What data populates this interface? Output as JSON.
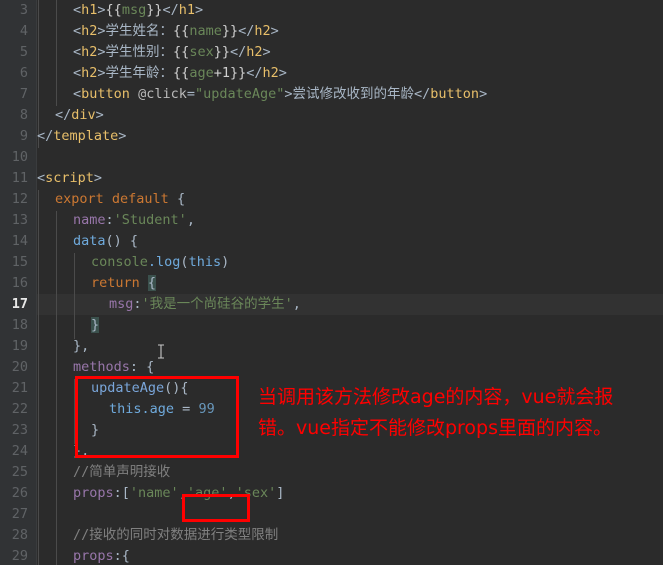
{
  "editor": {
    "background_color": "#2b2b2b",
    "gutter_color": "#313335",
    "active_line_color": "#323232",
    "annotation_color": "#ff0000",
    "first_visible_line": 3,
    "last_visible_line": 29,
    "active_line": 17
  },
  "line_numbers": [
    "3",
    "4",
    "5",
    "6",
    "7",
    "8",
    "9",
    "10",
    "11",
    "12",
    "13",
    "14",
    "15",
    "16",
    "17",
    "18",
    "19",
    "20",
    "21",
    "22",
    "23",
    "24",
    "25",
    "26",
    "27",
    "28",
    "29"
  ],
  "code_lines": [
    {
      "num": "3",
      "text": "    <h1>{{msg}}</h1>"
    },
    {
      "num": "4",
      "text": "    <h2>学生姓名：{{name}}</h2>"
    },
    {
      "num": "5",
      "text": "    <h2>学生性别：{{sex}}</h2>"
    },
    {
      "num": "6",
      "text": "    <h2>学生年龄：{{age+1}}</h2>"
    },
    {
      "num": "7",
      "text": "    <button @click=\"updateAge\">尝试修改收到的年龄</button>"
    },
    {
      "num": "8",
      "text": "  </div>"
    },
    {
      "num": "9",
      "text": "</template>"
    },
    {
      "num": "10",
      "text": ""
    },
    {
      "num": "11",
      "text": "<script>"
    },
    {
      "num": "12",
      "text": "  export default {"
    },
    {
      "num": "13",
      "text": "    name:'Student',"
    },
    {
      "num": "14",
      "text": "    data() {"
    },
    {
      "num": "15",
      "text": "      console.log(this)"
    },
    {
      "num": "16",
      "text": "      return {"
    },
    {
      "num": "17",
      "text": "        msg:'我是一个尚硅谷的学生',"
    },
    {
      "num": "18",
      "text": "      }"
    },
    {
      "num": "19",
      "text": "    },"
    },
    {
      "num": "20",
      "text": "    methods: {"
    },
    {
      "num": "21",
      "text": "      updateAge(){"
    },
    {
      "num": "22",
      "text": "        this.age = 99"
    },
    {
      "num": "23",
      "text": "      }"
    },
    {
      "num": "24",
      "text": "    },"
    },
    {
      "num": "25",
      "text": "    //简单声明接收"
    },
    {
      "num": "26",
      "text": "    props:['name','age','sex']"
    },
    {
      "num": "27",
      "text": ""
    },
    {
      "num": "28",
      "text": "    //接收的同时对数据进行类型限制"
    },
    {
      "num": "29",
      "text": "    props:{"
    }
  ],
  "annotations": {
    "note_line_1": "当调用该方法修改age的内容，vue就会报",
    "note_line_2": "错。vue指定不能修改props里面的内容。",
    "box_method_label": "updateAge-method-highlight-box",
    "box_props_label": "age-prop-highlight-box"
  },
  "tokens": {
    "h1_open": "<h1>",
    "h1_close": "</h1>",
    "h2_open": "<h2>",
    "h2_close": "</h2>",
    "msg_mustache": "{{msg}}",
    "name_mustache": "{{name}}",
    "sex_mustache": "{{sex}}",
    "age_mustache": "{{age+1}}",
    "label_name": "学生姓名：",
    "label_sex": "学生性别：",
    "label_age": "学生年龄：",
    "button_open": "<button",
    "button_attr": "@click",
    "button_attr_value": "\"updateAge\"",
    "button_text": "尝试修改收到的年龄",
    "button_close": "</button>",
    "div_close": "  </div>",
    "template_close": "</template>",
    "script_open": "<script>",
    "export_default": "export default",
    "name_key": "name",
    "student_value": "'Student'",
    "data_fn": "data",
    "console_obj": "console",
    "log_method": ".log",
    "this_kw": "this",
    "return_kw": "return",
    "msg_key": "msg",
    "msg_value": "'我是一个尚硅谷的学生'",
    "methods_key": "methods",
    "updateAge_fn": "updateAge",
    "this_age": "this.age",
    "assign_value": "99",
    "comment_simple": "//简单声明接收",
    "props_key": "props",
    "props_array": "['name','age','sex']",
    "comment_typed": "//接收的同时对数据进行类型限制",
    "props_key2": "props"
  }
}
